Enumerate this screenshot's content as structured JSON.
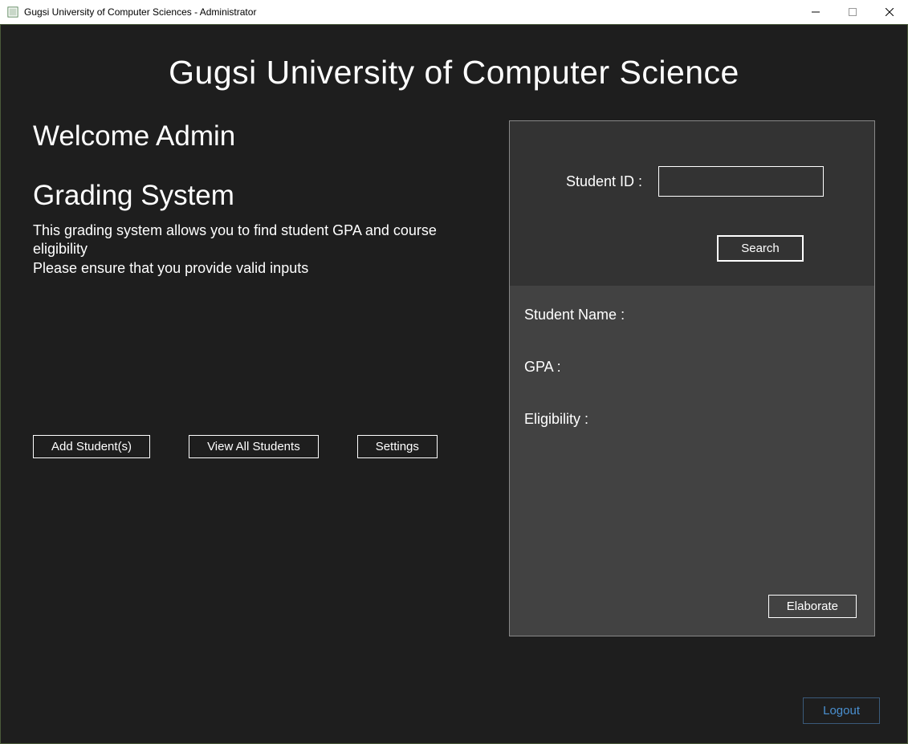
{
  "window": {
    "title": "Gugsi University of Computer Sciences - Administrator"
  },
  "header": {
    "title": "Gugsi University of Computer Science"
  },
  "left": {
    "welcome": "Welcome Admin",
    "section_title": "Grading System",
    "description": "This grading system allows you to find student GPA and course eligibility\nPlease ensure that you provide valid inputs",
    "add_students_btn": "Add Student(s)",
    "view_all_btn": "View All Students",
    "settings_btn": "Settings"
  },
  "search": {
    "student_id_label": "Student ID :",
    "student_id_value": "",
    "search_btn": "Search"
  },
  "results": {
    "student_name_label": "Student Name :",
    "gpa_label": "GPA :",
    "eligibility_label": "Eligibility :",
    "elaborate_btn": "Elaborate"
  },
  "footer": {
    "logout_btn": "Logout"
  }
}
